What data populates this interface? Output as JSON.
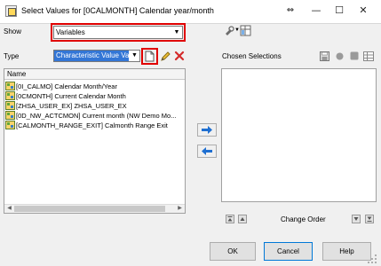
{
  "window": {
    "title": "Select Values for [0CALMONTH] Calendar year/month",
    "resize_icon": "⇔",
    "minimize_icon": "—",
    "maximize_icon": "☐",
    "close_icon": "✕"
  },
  "show": {
    "label": "Show",
    "value": "Variables"
  },
  "type_row": {
    "label": "Type",
    "value": "Characteristic Value Va"
  },
  "list": {
    "column_header": "Name",
    "rows": [
      "[0I_CALMO] Calendar Month/Year",
      "[0CMONTH] Current Calendar Month",
      "[ZHSA_USER_EX] ZHSA_USER_EX",
      "[0D_NW_ACTCMON] Current month (NW Demo Mo...",
      "[CALMONTH_RANGE_EXIT] Calmonth Range Exit"
    ]
  },
  "chosen": {
    "title": "Chosen Selections",
    "change_order_label": "Change Order"
  },
  "buttons": {
    "ok": "OK",
    "cancel": "Cancel",
    "help": "Help"
  },
  "colors": {
    "highlight_red": "#e00000",
    "selection_blue": "#3376d6",
    "arrow_blue": "#1f6fd1"
  }
}
